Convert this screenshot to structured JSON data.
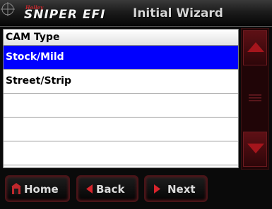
{
  "header": {
    "brand_small": "Holley",
    "brand_logo": "SNIPER EFI",
    "title": "Initial Wizard"
  },
  "list": {
    "column_header": "CAM Type",
    "selected_index": 0,
    "rows": [
      {
        "label": "Stock/Mild"
      },
      {
        "label": "Street/Strip"
      },
      {
        "label": ""
      },
      {
        "label": ""
      },
      {
        "label": ""
      }
    ]
  },
  "scrollbar": {
    "up_icon": "triangle-up-icon",
    "down_icon": "triangle-down-icon",
    "thumb_icon": "grip-lines-icon"
  },
  "buttons": {
    "home": {
      "label": "Home",
      "icon": "home-icon"
    },
    "back": {
      "label": "Back",
      "icon": "triangle-left-icon"
    },
    "next": {
      "label": "Next",
      "icon": "triangle-right-icon"
    }
  },
  "colors": {
    "selection": "#0000ff",
    "accent_red": "#c0282d",
    "background": "#0a0a0a"
  }
}
